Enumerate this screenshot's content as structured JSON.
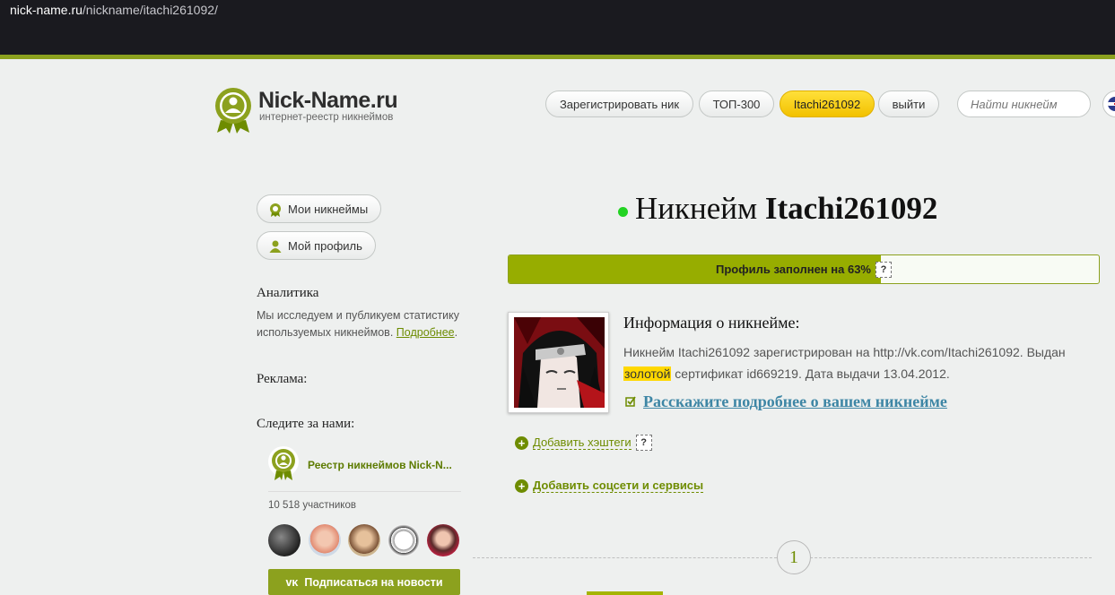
{
  "browser": {
    "url_domain": "nick-name.ru",
    "url_path": "/nickname/itachi261092/"
  },
  "logo": {
    "name": "Nick-Name.ru",
    "tagline": "интернет-реестр никнеймов"
  },
  "nav": {
    "register": "Зарегистрировать ник",
    "top300": "ТОП-300",
    "user": "Itachi261092",
    "logout": "выйти",
    "search_placeholder": "Найти никнейм"
  },
  "sidebar": {
    "my_nicknames": "Мои никнеймы",
    "my_profile": "Мой профиль",
    "analytics_title": "Аналитика",
    "analytics_text": "Мы исследуем и публикуем статистику используемых никнеймов.",
    "analytics_link": "Подробнее",
    "ads_title": "Реклама:",
    "follow_title": "Следите за нами:",
    "vk_group_name": "Реестр никнеймов Nick-N...",
    "vk_members": "10 518 участников",
    "vk_subscribe": "Подписаться на новости"
  },
  "main": {
    "title_prefix": "Никнейм",
    "title_nick": "Itachi261092",
    "progress_label": "Профиль заполнен на 63%",
    "progress_value": 0.63,
    "help_mark": "?",
    "info_title": "Информация о никнейме:",
    "info_part1": "Никнейм Itachi261092 зарегистрирован на http://vk.com/Itachi261092. Выдан",
    "info_gold": "золотой",
    "info_part2": "сертификат id669219. Дата выдачи 13.04.2012.",
    "tell_more": "Расскажите подробнее о вашем никнейме",
    "add_hashtags": "Добавить хэштеги",
    "add_social": "Добавить соцсети и сервисы",
    "page_number": "1"
  },
  "colors": {
    "brand_green": "#8ca11e",
    "active_yellow": "#ffd800",
    "link_blue": "#3e86a5",
    "status_dot": "#22d322"
  }
}
